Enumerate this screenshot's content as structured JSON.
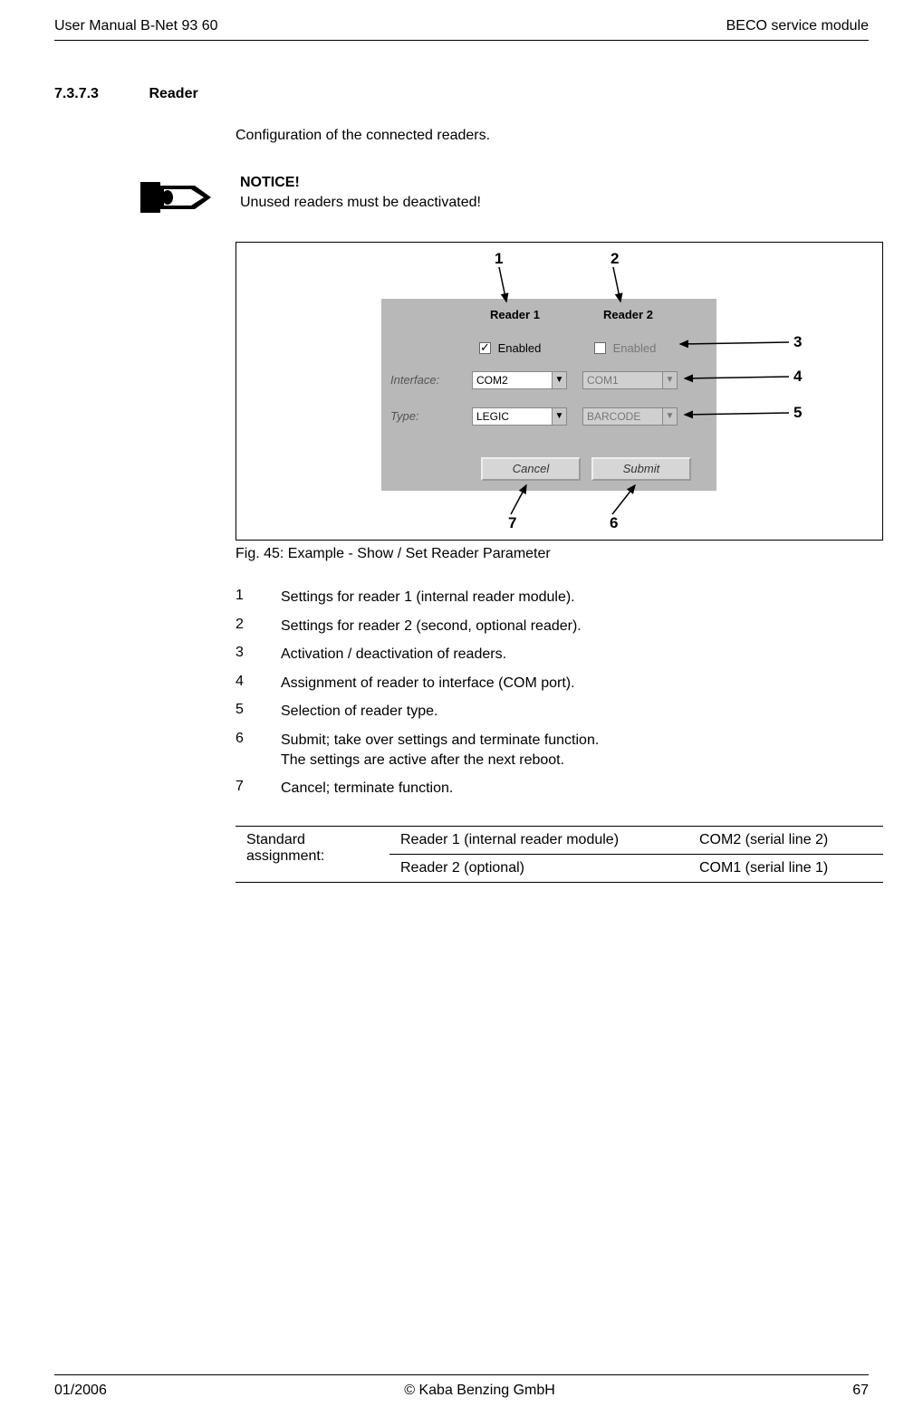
{
  "header": {
    "left": "User Manual B-Net 93 60",
    "right": "BECO service module"
  },
  "section": {
    "number": "7.3.7.3",
    "title": "Reader"
  },
  "intro": "Configuration of the connected readers.",
  "notice": {
    "title": "NOTICE!",
    "body": "Unused readers must be deactivated!"
  },
  "panel": {
    "hdr1": "Reader 1",
    "hdr2": "Reader 2",
    "enabled_label": "Enabled",
    "interface_label": "Interface:",
    "type_label": "Type:",
    "sel_com2": "COM2",
    "sel_com1": "COM1",
    "sel_legic": "LEGIC",
    "sel_barcode": "BARCODE",
    "btn_cancel": "Cancel",
    "btn_submit": "Submit"
  },
  "callouts": {
    "c1": "1",
    "c2": "2",
    "c3": "3",
    "c4": "4",
    "c5": "5",
    "c6": "6",
    "c7": "7"
  },
  "caption": "Fig. 45: Example - Show / Set Reader Parameter",
  "legend": [
    {
      "n": "1",
      "t": "Settings for reader 1 (internal reader module)."
    },
    {
      "n": "2",
      "t": "Settings for reader 2 (second, optional reader)."
    },
    {
      "n": "3",
      "t": "Activation / deactivation of readers."
    },
    {
      "n": "4",
      "t": "Assignment of reader to interface (COM port)."
    },
    {
      "n": "5",
      "t": "Selection of reader type."
    },
    {
      "n": "6",
      "t": "Submit; take over settings and terminate function.\nThe settings are active after the next reboot."
    },
    {
      "n": "7",
      "t": "Cancel; terminate function."
    }
  ],
  "assign": {
    "label": "Standard assignment:",
    "r1a": "Reader 1 (internal reader module)",
    "r1b": "COM2 (serial line 2)",
    "r2a": "Reader 2 (optional)",
    "r2b": "COM1 (serial line 1)"
  },
  "footer": {
    "left": "01/2006",
    "center": "© Kaba Benzing GmbH",
    "right": "67"
  }
}
